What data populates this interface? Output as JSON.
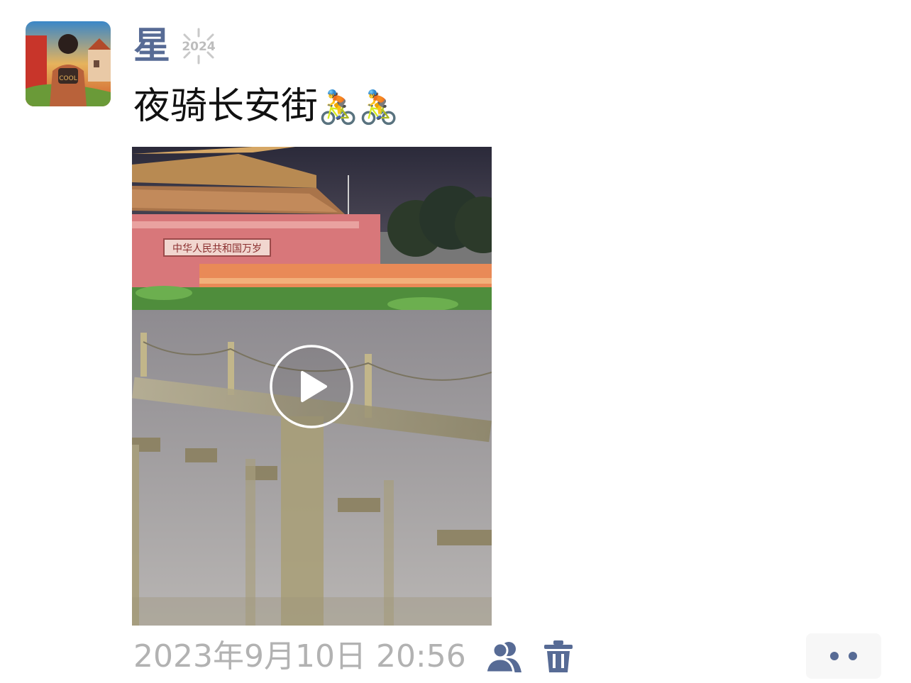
{
  "post": {
    "author": "星",
    "badge_text": "2024",
    "text": "夜骑长安街",
    "emoji": [
      "🚴",
      "🚴"
    ],
    "timestamp": "2023年9月10日 20:56"
  },
  "media": {
    "type": "video",
    "gate_sign": "中华人民共和国万岁"
  },
  "colors": {
    "name": "#576b95",
    "timestamp": "#b2b2b2",
    "text": "#111111",
    "more_bg": "#f7f7f7"
  },
  "icons": [
    "user-avatar",
    "year-2024-badge",
    "cyclist-icon",
    "play-icon",
    "visibility-friends-icon",
    "trash-icon",
    "more-dots-icon"
  ]
}
